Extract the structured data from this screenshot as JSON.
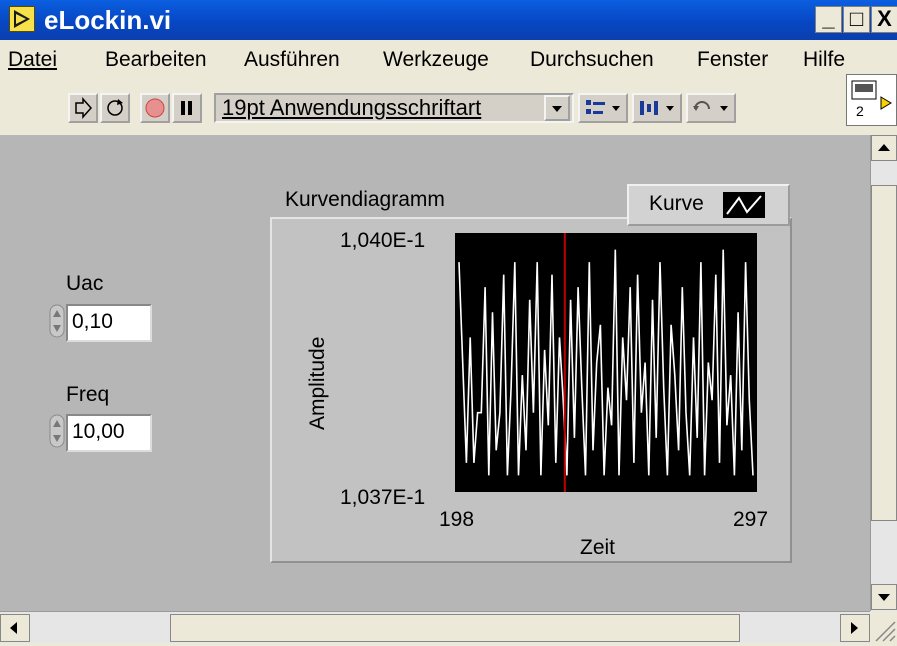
{
  "window": {
    "title": "eLockin.vi",
    "minimize": "_",
    "maximize": "□",
    "close": "X"
  },
  "menu": [
    {
      "label": "Datei"
    },
    {
      "label": "Bearbeiten"
    },
    {
      "label": "Ausführen"
    },
    {
      "label": "Werkzeuge"
    },
    {
      "label": "Durchsuchen"
    },
    {
      "label": "Fenster"
    },
    {
      "label": "Hilfe"
    }
  ],
  "toolbar": {
    "font": "19pt Anwendungsschriftart"
  },
  "connector": {
    "label": "2"
  },
  "controls": {
    "uac": {
      "label": "Uac",
      "value": "0,10"
    },
    "freq": {
      "label": "Freq",
      "value": "10,00"
    }
  },
  "colors": {
    "titlebar": "#0747c4",
    "panel": "#b6b6b6",
    "plot_bg": "#000000",
    "trace": "#ffffff",
    "cursor": "#c00000"
  },
  "chart_data": {
    "type": "line",
    "title": "Kurvendiagramm",
    "xlabel": "Zeit",
    "ylabel": "Amplitude",
    "legend": "Kurve",
    "xlim": [
      198,
      297
    ],
    "ylim_labels": [
      "1,040E-1",
      "1,037E-1"
    ],
    "x_tick_labels": [
      "198",
      "297"
    ],
    "cursor_x": 234,
    "y": [
      0.9,
      0.5,
      0.1,
      0.6,
      0.1,
      0.3,
      0.3,
      0.8,
      0.05,
      0.7,
      0.15,
      0.3,
      0.85,
      0.05,
      0.4,
      0.9,
      0.05,
      0.45,
      0.15,
      0.75,
      0.3,
      0.9,
      0.05,
      0.55,
      0.25,
      0.85,
      0.1,
      0.6,
      0.35,
      0.05,
      0.75,
      0.2,
      0.8,
      0.4,
      0.05,
      0.9,
      0.15,
      0.5,
      0.65,
      0.05,
      0.4,
      0.25,
      0.95,
      0.05,
      0.6,
      0.35,
      0.8,
      0.1,
      0.85,
      0.3,
      0.5,
      0.05,
      0.75,
      0.2,
      0.9,
      0.4,
      0.05,
      0.65,
      0.45,
      0.15,
      0.8,
      0.3,
      0.05,
      0.6,
      0.2,
      0.9,
      0.05,
      0.5,
      0.35,
      0.85,
      0.1,
      0.95,
      0.25,
      0.45,
      0.05,
      0.7,
      0.15,
      0.9,
      0.35,
      0.05
    ]
  }
}
